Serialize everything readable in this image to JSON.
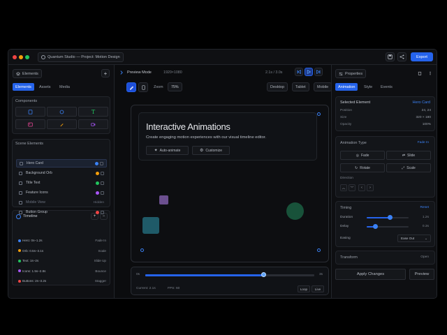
{
  "titlebar": {
    "project_title": "Quantum Studio — Project: Motion Design",
    "export_label": "Export"
  },
  "left": {
    "header": "Elements",
    "tabs": [
      "Elements",
      "Assets",
      "Media"
    ],
    "components_label": "Components",
    "scene_label": "Scene Elements",
    "scene_items": [
      {
        "name": "Hero Card",
        "color": "#3b82f6",
        "status": "",
        "selected": true
      },
      {
        "name": "Background Orb",
        "color": "#f59e0b",
        "status": ""
      },
      {
        "name": "Title Text",
        "color": "#22c55e",
        "status": ""
      },
      {
        "name": "Feature Icons",
        "color": "#a855f7",
        "status": ""
      },
      {
        "name": "Mobile View",
        "color": "",
        "status": "Hidden",
        "dim": true
      },
      {
        "name": "Button Group",
        "color": "#ef4444",
        "status": ""
      }
    ],
    "timeline_label": "Timeline",
    "timeline_rows": [
      {
        "name": "Hero: 0s–1.2s",
        "anim": "Fade In",
        "color": "#3b82f6"
      },
      {
        "name": "Orb: 0.5s–3.1s",
        "anim": "Scale",
        "color": "#f59e0b"
      },
      {
        "name": "Text: 1s–2s",
        "anim": "Slide Up",
        "color": "#22c55e"
      },
      {
        "name": "Icons: 1.5s–2.8s",
        "anim": "Bounce",
        "color": "#a855f7"
      },
      {
        "name": "Buttons: 2s–3.2s",
        "anim": "Stagger",
        "color": "#ef4444"
      }
    ]
  },
  "mid": {
    "mode_label": "Preview Mode",
    "resolution": "1920×1080",
    "time": "2.1s / 3.0s",
    "zoom_label": "Zoom",
    "zoom_value": "75%",
    "view_tabs": [
      "Desktop",
      "Tablet",
      "Mobile"
    ],
    "hero_title": "Interactive Animations",
    "hero_subtitle": "Create engaging motion experiences with our visual timeline editor.",
    "primary_btn": "Auto-animate",
    "secondary_btn": "Customize",
    "scrub_start": "0s",
    "scrub_end": "3s",
    "scrub_progress": 0.7,
    "current_label": "Current: 2.1s",
    "fps_label": "FPS: 60",
    "loop_label": "Loop",
    "live_label": "Live"
  },
  "right": {
    "header": "Properties",
    "tabs": [
      "Animation",
      "Style",
      "Events"
    ],
    "selected_label": "Selected Element",
    "selected_value": "Hero Card",
    "props": [
      {
        "k": "Position",
        "v": "24, 24"
      },
      {
        "k": "Size",
        "v": "320 × 180"
      },
      {
        "k": "Opacity",
        "v": "100%"
      }
    ],
    "anim_type_label": "Animation Type",
    "anim_type_value": "Fade In",
    "anim_buttons": [
      "Fade",
      "Slide",
      "Rotate",
      "Scale"
    ],
    "direction_label": "Direction",
    "timing_label": "Timing",
    "timing_link": "Reset",
    "duration_label": "Duration",
    "duration_value": "1.2s",
    "duration_level": 0.55,
    "delay_label": "Delay",
    "delay_value": "0.3s",
    "delay_level": 0.2,
    "easing_label": "Easing",
    "easing_value": "Ease Out",
    "transform_label": "Transform",
    "transform_link": "Open",
    "apply_label": "Apply Changes",
    "preview_label": "Preview"
  }
}
